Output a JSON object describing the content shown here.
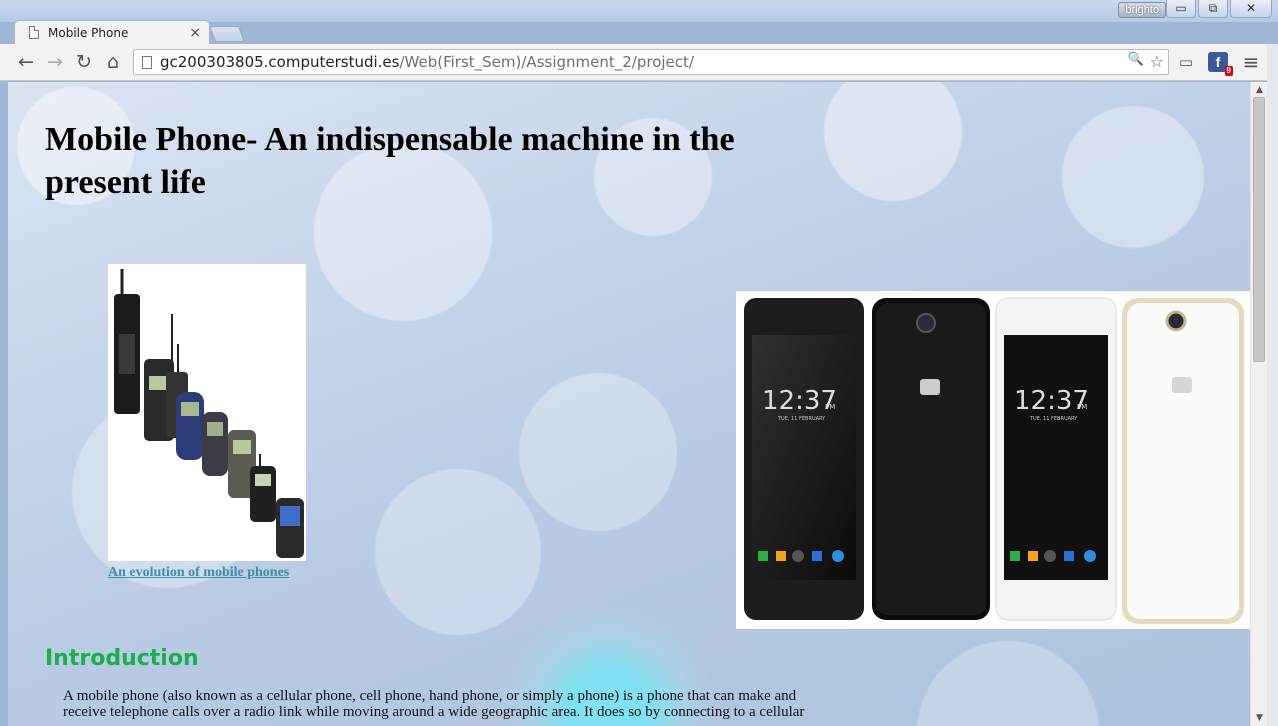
{
  "browser": {
    "profile_label": "brighto",
    "win_controls": {
      "minimize": "▭",
      "restore": "⧉",
      "close": "✕"
    },
    "tab": {
      "title": "Mobile Phone",
      "close": "×"
    },
    "toolbar": {
      "back": "←",
      "forward": "→",
      "reload": "↻",
      "home": "⌂"
    },
    "omnibox": {
      "domain": "gc200303805.computerstudi.es",
      "path": "/Web(First_Sem)/Assignment_2/project/"
    },
    "omni_icons": {
      "zoom": "🔍",
      "star": "☆"
    },
    "extensions": {
      "cast": "▭",
      "facebook": "f",
      "facebook_badge": "9",
      "menu": "≡"
    }
  },
  "page": {
    "title": "Mobile Phone- An indispensable machine in the present life",
    "evolution_caption": "An evolution of mobile phones",
    "phones": [
      {
        "time": "12:37",
        "ampm": "PM",
        "date": "TUE, 11 FEBRUARY"
      },
      {
        "time": "12:37",
        "ampm": "PM",
        "date": "TUE, 11 FEBRUARY"
      }
    ],
    "intro_heading": "Introduction",
    "intro_text": "A mobile phone (also known as a cellular phone, cell phone, hand phone, or simply a phone) is a phone that can make and receive telephone calls over a radio link while moving around a wide geographic area. It does so by connecting to a cellular"
  },
  "scrollbar": {
    "up": "▲",
    "down": "▼"
  }
}
